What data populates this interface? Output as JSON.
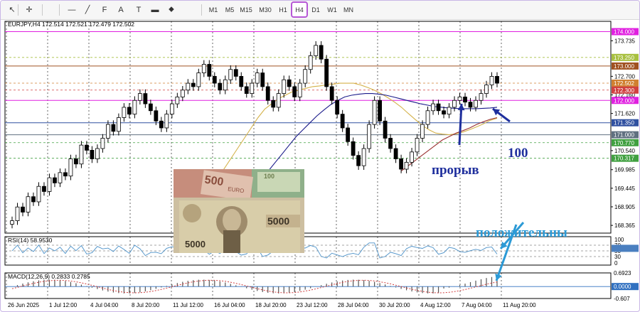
{
  "toolbar": {
    "tools": [
      {
        "name": "cursor-icon",
        "glyph": "↖"
      },
      {
        "name": "crosshair-icon",
        "glyph": "✛"
      },
      {
        "name": "horizontal-line-icon",
        "glyph": "—"
      },
      {
        "name": "trendline-icon",
        "glyph": "╱"
      },
      {
        "name": "fibonacci-icon",
        "glyph": "F"
      },
      {
        "name": "text-icon",
        "glyph": "A"
      },
      {
        "name": "text-label-icon",
        "glyph": "T"
      },
      {
        "name": "rectangle-icon",
        "glyph": "▬"
      },
      {
        "name": "shapes-icon",
        "glyph": "⬥"
      }
    ],
    "timeframes": [
      "M1",
      "M5",
      "M15",
      "M30",
      "H1",
      "H4",
      "D1",
      "W1",
      "MN"
    ],
    "active_timeframe": "H4"
  },
  "chart_header": {
    "title": "EURJPY,H4  172.514 172.521 172.479 172.502"
  },
  "rsi_header": "RSI(14) 58.9530",
  "macd_header": "MACD(12,26,9) 0.2833 0.2785",
  "annotations": {
    "breakout": "прорыв",
    "ma100": "100",
    "positive": "положительны"
  },
  "colors": {
    "up": "#000000",
    "level_magenta": "#e020e0",
    "ma_yellow": "#d4b24a",
    "ma_blue": "#1a1a8a",
    "ma_red": "#9a3030",
    "rsi_line": "#4a90c8",
    "annotation_navy": "#1f2f9d",
    "annotation_light": "#2c9ad6"
  },
  "chart_data": {
    "type": "candlestick",
    "symbol": "EURJPY",
    "timeframe": "H4",
    "ylim": [
      168.14,
      174.3
    ],
    "x_labels": [
      "26 Jun 2025",
      "1 Jul 12:00",
      "4 Jul 04:00",
      "8 Jul 20:00",
      "11 Jul 12:00",
      "16 Jul 04:00",
      "18 Jul 20:00",
      "23 Jul 12:00",
      "28 Jul 04:00",
      "30 Jul 20:00",
      "4 Aug 12:00",
      "7 Aug 04:00",
      "11 Aug 20:00"
    ],
    "y_ticks": [
      {
        "value": 173.735,
        "label": "173.735"
      },
      {
        "value": 172.7,
        "label": "172.700"
      },
      {
        "value": 172.16,
        "label": "172.160"
      },
      {
        "value": 171.62,
        "label": "171.620"
      },
      {
        "value": 170.54,
        "label": "170.540"
      },
      {
        "value": 169.985,
        "label": "169.985"
      },
      {
        "value": 169.445,
        "label": "169.445"
      },
      {
        "value": 168.905,
        "label": "168.905"
      },
      {
        "value": 168.365,
        "label": "168.365"
      }
    ],
    "price_levels": [
      {
        "value": 174.0,
        "label": "174.000",
        "color": "#e020e0"
      },
      {
        "value": 173.25,
        "label": "173.250",
        "color": "#a8c040"
      },
      {
        "value": 173.0,
        "label": "173.000",
        "color": "#a05020"
      },
      {
        "value": 172.502,
        "label": "172.502",
        "color": "#d08030"
      },
      {
        "value": 172.3,
        "label": "172.300",
        "color": "#d04040"
      },
      {
        "value": 172.0,
        "label": "172.000",
        "color": "#e020e0"
      },
      {
        "value": 171.35,
        "label": "171.350",
        "color": "#3050a0"
      },
      {
        "value": 171.0,
        "label": "171.000",
        "color": "#607080"
      },
      {
        "value": 170.77,
        "label": "170.770",
        "color": "#40a040"
      },
      {
        "value": 170.317,
        "label": "170.317",
        "color": "#40a040"
      }
    ],
    "close": [
      168.5,
      168.9,
      168.75,
      169.2,
      169.05,
      169.5,
      169.35,
      169.75,
      169.6,
      169.9,
      169.8,
      170.3,
      170.15,
      170.7,
      170.55,
      170.3,
      170.6,
      170.9,
      171.3,
      171.1,
      171.5,
      171.8,
      171.6,
      172.0,
      172.2,
      171.9,
      171.7,
      171.4,
      171.2,
      171.6,
      171.9,
      172.1,
      172.3,
      172.5,
      172.4,
      172.8,
      173.05,
      172.7,
      172.5,
      172.3,
      172.6,
      172.9,
      172.7,
      172.4,
      172.2,
      172.5,
      172.8,
      172.4,
      172.0,
      171.8,
      172.2,
      172.6,
      172.4,
      172.1,
      172.5,
      172.9,
      173.3,
      173.6,
      173.2,
      172.4,
      172.0,
      171.6,
      171.2,
      170.8,
      170.4,
      170.1,
      170.6,
      171.3,
      172.0,
      171.4,
      170.9,
      170.6,
      170.3,
      170.0,
      170.2,
      170.5,
      170.9,
      171.3,
      171.7,
      171.9,
      171.7,
      171.6,
      171.8,
      172.0,
      172.1,
      171.95,
      171.8,
      172.0,
      172.2,
      172.45,
      172.7,
      172.5
    ],
    "ma_yellow": [
      null,
      null,
      null,
      null,
      null,
      null,
      null,
      null,
      null,
      null,
      null,
      null,
      null,
      null,
      null,
      null,
      null,
      null,
      null,
      null,
      null,
      null,
      null,
      null,
      null,
      null,
      null,
      null,
      null,
      null,
      169.8,
      170.0,
      170.3,
      170.6,
      170.9,
      171.2,
      171.5,
      171.75,
      171.9,
      172.05,
      172.15,
      172.25,
      172.3,
      172.35,
      172.4,
      172.42,
      172.45,
      172.47,
      172.5,
      172.5,
      172.5,
      172.45,
      172.38,
      172.3,
      172.2,
      172.08,
      171.95,
      171.8,
      171.62,
      171.45,
      171.28,
      171.15,
      171.05,
      171.02,
      171.0,
      171.03,
      171.08,
      171.15,
      171.23,
      171.32,
      171.42,
      171.48
    ],
    "ma_blue": [
      null,
      null,
      null,
      null,
      null,
      null,
      null,
      null,
      null,
      null,
      null,
      null,
      null,
      null,
      null,
      null,
      null,
      null,
      null,
      null,
      null,
      null,
      null,
      null,
      null,
      null,
      null,
      null,
      null,
      null,
      168.2,
      168.45,
      168.7,
      168.95,
      169.2,
      169.45,
      169.7,
      169.95,
      170.2,
      170.45,
      170.7,
      170.95,
      171.15,
      171.35,
      171.55,
      171.72,
      171.88,
      172.0,
      172.1,
      172.15,
      172.18,
      172.2,
      172.2,
      172.18,
      172.15,
      172.1,
      172.05,
      172.0,
      171.95,
      171.9,
      171.86,
      171.82,
      171.8,
      171.78,
      171.77,
      171.76,
      171.76,
      171.76,
      171.77,
      171.78,
      171.8
    ],
    "ma_red": [
      null,
      null,
      null,
      null,
      null,
      null,
      null,
      null,
      null,
      null,
      null,
      null,
      null,
      null,
      null,
      null,
      null,
      null,
      null,
      null,
      null,
      null,
      null,
      null,
      null,
      null,
      null,
      null,
      null,
      null,
      null,
      null,
      null,
      null,
      null,
      null,
      null,
      null,
      null,
      null,
      null,
      null,
      null,
      null,
      null,
      null,
      null,
      null,
      null,
      null,
      null,
      null,
      null,
      null,
      null,
      null,
      null,
      169.95,
      170.1,
      170.25,
      170.4,
      170.55,
      170.7,
      170.85,
      170.95,
      171.05,
      171.12,
      171.2,
      171.3,
      171.38,
      171.45,
      171.5
    ],
    "rsi": {
      "value": 58.953,
      "levels": [
        70,
        50,
        30
      ],
      "ylim": [
        0,
        100
      ]
    },
    "macd": {
      "main": 0.2833,
      "signal": 0.2785,
      "ylim": [
        -0.607,
        0.6923
      ],
      "tick_labels": [
        "0.6923",
        "0.0000",
        "-0.607"
      ]
    }
  }
}
